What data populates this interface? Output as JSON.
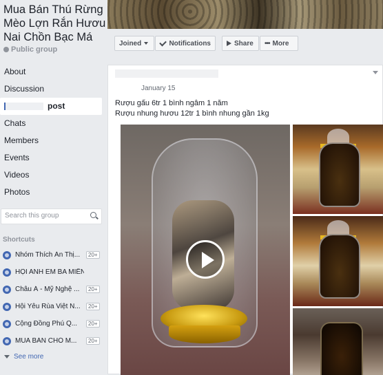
{
  "group": {
    "title": "Mua Bán Thú Rừng Mèo Lợn Rắn Hươu Nai Chồn Bạc Má",
    "privacy": "Public group"
  },
  "nav": {
    "items": [
      "About",
      "Discussion",
      "post",
      "Chats",
      "Members",
      "Events",
      "Videos",
      "Photos"
    ],
    "active_index": 2
  },
  "search": {
    "placeholder": "Search this group"
  },
  "shortcuts": {
    "heading": "Shortcuts",
    "items": [
      {
        "name": "Nhóm Thích Ăn Thị...",
        "badge": "20+"
      },
      {
        "name": "HỘI ANH EM BA MIỀN",
        "badge": ""
      },
      {
        "name": "Châu Á - Mỹ Nghệ ...",
        "badge": "20+"
      },
      {
        "name": "Hội Yêu Rùa Việt N...",
        "badge": "20+"
      },
      {
        "name": "Cộng Đồng Phú Q...",
        "badge": "20+"
      },
      {
        "name": "MUA BÁN CHÓ M...",
        "badge": "20+"
      }
    ],
    "see_more": "See more"
  },
  "actions": {
    "joined": "Joined",
    "notifications": "Notifications",
    "share": "Share",
    "more": "More"
  },
  "post": {
    "date": "January 15",
    "lines": [
      "Rượu gấu 6tr 1 bình ngâm 1 năm",
      "Rượu nhung hươu 12tr 1 bình nhung gần 1kg"
    ]
  },
  "colors": {
    "accent": "#4267b2",
    "background": "#e9ebee"
  }
}
